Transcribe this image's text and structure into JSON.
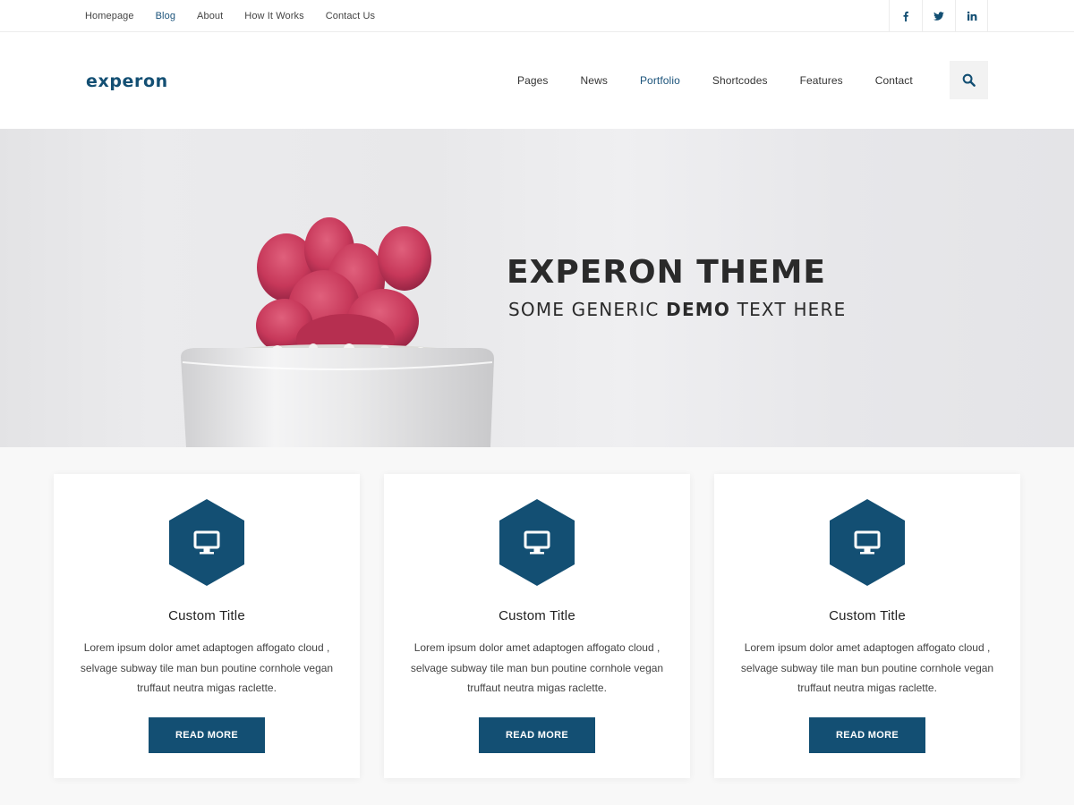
{
  "topbar": {
    "links": [
      {
        "label": "Homepage",
        "active": false
      },
      {
        "label": "Blog",
        "active": true
      },
      {
        "label": "About",
        "active": false
      },
      {
        "label": "How It Works",
        "active": false
      },
      {
        "label": "Contact Us",
        "active": false
      }
    ],
    "social_icons": [
      "facebook-icon",
      "twitter-icon",
      "linkedin-icon"
    ]
  },
  "header": {
    "logo": "experon",
    "nav": [
      {
        "label": "Pages",
        "active": false
      },
      {
        "label": "News",
        "active": false
      },
      {
        "label": "Portfolio",
        "active": true
      },
      {
        "label": "Shortcodes",
        "active": false
      },
      {
        "label": "Features",
        "active": false
      },
      {
        "label": "Contact",
        "active": false
      }
    ],
    "search_icon": "search-icon"
  },
  "hero": {
    "title": "EXPERON THEME",
    "subtitle_pre": "SOME GENERIC ",
    "subtitle_bold": "DEMO",
    "subtitle_post": " TEXT HERE"
  },
  "features": [
    {
      "icon": "monitor-icon",
      "title": "Custom Title",
      "text": "Lorem ipsum dolor amet adaptogen affogato cloud , selvage subway tile man bun poutine cornhole vegan truffaut neutra migas raclette.",
      "button": "READ MORE"
    },
    {
      "icon": "monitor-icon",
      "title": "Custom Title",
      "text": "Lorem ipsum dolor amet adaptogen affogato cloud , selvage subway tile man bun poutine cornhole vegan truffaut neutra migas raclette.",
      "button": "READ MORE"
    },
    {
      "icon": "monitor-icon",
      "title": "Custom Title",
      "text": "Lorem ipsum dolor amet adaptogen affogato cloud , selvage subway tile man bun poutine cornhole vegan truffaut neutra migas raclette.",
      "button": "READ MORE"
    }
  ],
  "colors": {
    "brand": "#134f73",
    "active_link": "#1a527a",
    "hero_bg": "#ebebed",
    "plant": "#c43a5a"
  }
}
